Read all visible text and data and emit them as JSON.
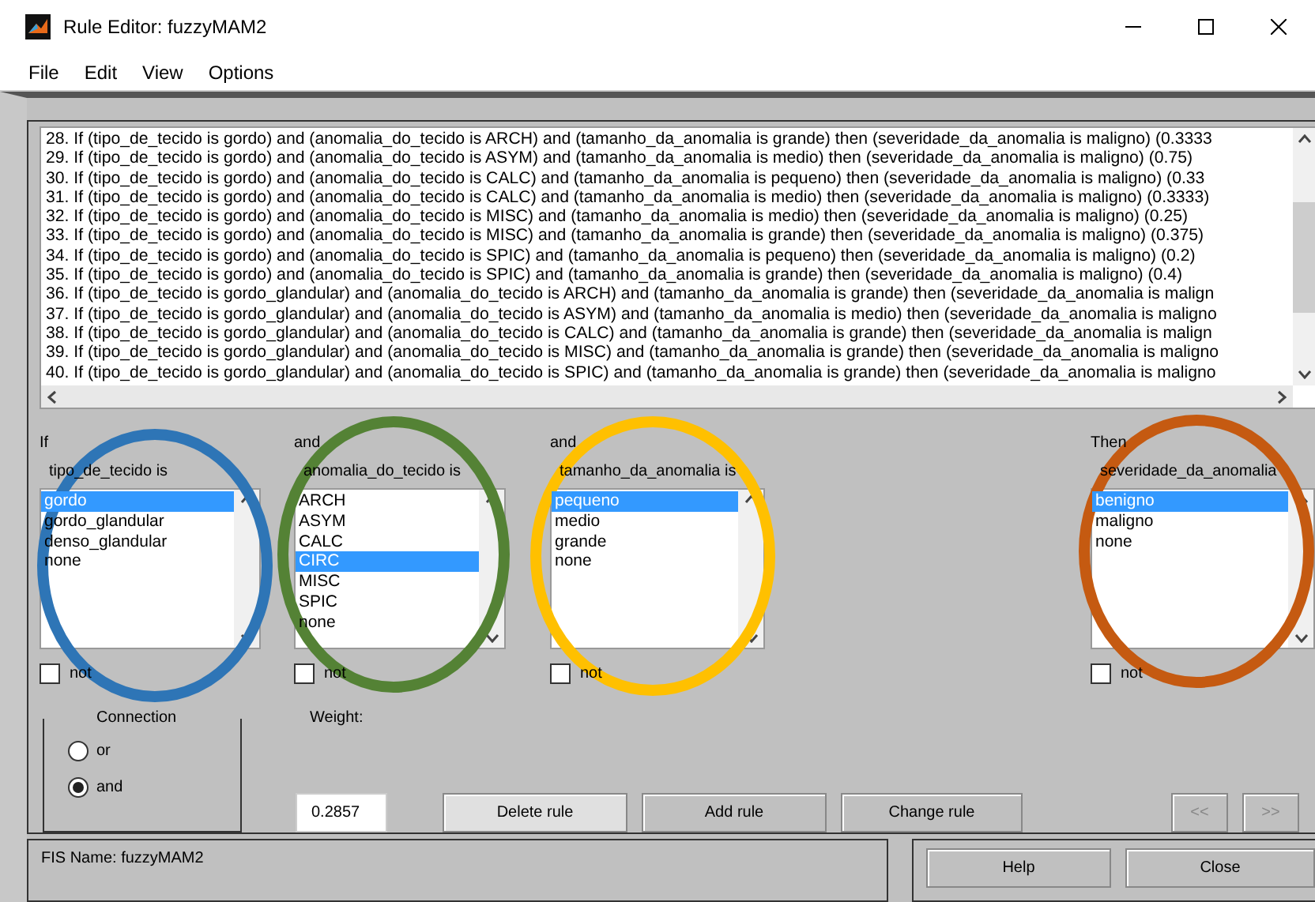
{
  "window": {
    "title": "Rule Editor: fuzzyMAM2"
  },
  "menu": [
    "File",
    "Edit",
    "View",
    "Options"
  ],
  "rules": [
    "28. If (tipo_de_tecido is gordo) and (anomalia_do_tecido is ARCH) and (tamanho_da_anomalia is grande) then (severidade_da_anomalia is maligno) (0.3333",
    "29. If (tipo_de_tecido is gordo) and (anomalia_do_tecido is ASYM) and (tamanho_da_anomalia is medio) then (severidade_da_anomalia is maligno) (0.75)",
    "30. If (tipo_de_tecido is gordo) and (anomalia_do_tecido is CALC) and (tamanho_da_anomalia is pequeno) then (severidade_da_anomalia is maligno) (0.33",
    "31. If (tipo_de_tecido is gordo) and (anomalia_do_tecido is CALC) and (tamanho_da_anomalia is medio) then (severidade_da_anomalia is maligno) (0.3333)",
    "32. If (tipo_de_tecido is gordo) and (anomalia_do_tecido is MISC) and (tamanho_da_anomalia is medio) then (severidade_da_anomalia is maligno) (0.25)",
    "33. If (tipo_de_tecido is gordo) and (anomalia_do_tecido is MISC) and (tamanho_da_anomalia is grande) then (severidade_da_anomalia is maligno) (0.375)",
    "34. If (tipo_de_tecido is gordo) and (anomalia_do_tecido is SPIC) and (tamanho_da_anomalia is pequeno) then (severidade_da_anomalia is maligno) (0.2)",
    "35. If (tipo_de_tecido is gordo) and (anomalia_do_tecido is SPIC) and (tamanho_da_anomalia is grande) then (severidade_da_anomalia is maligno) (0.4)",
    "36. If (tipo_de_tecido is gordo_glandular) and (anomalia_do_tecido is ARCH) and (tamanho_da_anomalia is grande) then (severidade_da_anomalia is malign",
    "37. If (tipo_de_tecido is gordo_glandular) and (anomalia_do_tecido is ASYM) and (tamanho_da_anomalia is medio) then (severidade_da_anomalia is maligno",
    "38. If (tipo_de_tecido is gordo_glandular) and (anomalia_do_tecido is CALC) and (tamanho_da_anomalia is grande) then (severidade_da_anomalia is malign",
    "39. If (tipo_de_tecido is gordo_glandular) and (anomalia_do_tecido is MISC) and (tamanho_da_anomalia is grande) then (severidade_da_anomalia is maligno",
    "40. If (tipo_de_tecido is gordo_glandular) and (anomalia_do_tecido is SPIC) and (tamanho_da_anomalia is grande) then (severidade_da_anomalia is maligno"
  ],
  "selectors": [
    {
      "header": "If",
      "variable": "tipo_de_tecido is",
      "items": [
        {
          "label": "gordo",
          "selected": true
        },
        {
          "label": "gordo_glandular",
          "selected": false
        },
        {
          "label": "denso_glandular",
          "selected": false
        },
        {
          "label": "none",
          "selected": false
        }
      ],
      "negate": {
        "label": "not",
        "checked": false
      }
    },
    {
      "header": "and",
      "variable": "anomalia_do_tecido is",
      "items": [
        {
          "label": "ARCH",
          "selected": false
        },
        {
          "label": "ASYM",
          "selected": false
        },
        {
          "label": "CALC",
          "selected": false
        },
        {
          "label": "CIRC",
          "selected": true
        },
        {
          "label": "MISC",
          "selected": false
        },
        {
          "label": "SPIC",
          "selected": false
        },
        {
          "label": "none",
          "selected": false
        }
      ],
      "negate": {
        "label": "not",
        "checked": false
      }
    },
    {
      "header": "and",
      "variable": "tamanho_da_anomalia is",
      "items": [
        {
          "label": "pequeno",
          "selected": true
        },
        {
          "label": "medio",
          "selected": false
        },
        {
          "label": "grande",
          "selected": false
        },
        {
          "label": "none",
          "selected": false
        }
      ],
      "negate": {
        "label": "not",
        "checked": false
      }
    },
    {
      "header": "Then",
      "variable": "severidade_da_anomalia",
      "items": [
        {
          "label": "benigno",
          "selected": true
        },
        {
          "label": "maligno",
          "selected": false
        },
        {
          "label": "none",
          "selected": false
        }
      ],
      "negate": {
        "label": "not",
        "checked": false
      }
    }
  ],
  "connection": {
    "title": "Connection",
    "options": [
      {
        "label": "or",
        "selected": false
      },
      {
        "label": "and",
        "selected": true
      }
    ]
  },
  "weight": {
    "label": "Weight:",
    "value": "0.2857"
  },
  "buttons": [
    {
      "label": "Delete rule",
      "disabled": false
    },
    {
      "label": "Add rule",
      "disabled": false
    },
    {
      "label": "Change rule",
      "disabled": false
    },
    {
      "label": "<<",
      "disabled": true
    },
    {
      "label": ">>",
      "disabled": true
    }
  ],
  "status": "FIS Name: fuzzyMAM2",
  "footer_buttons": [
    "Help",
    "Close"
  ],
  "marks": [
    {
      "color": "#2e75b6"
    },
    {
      "color": "#548235"
    },
    {
      "color": "#ffc000"
    },
    {
      "color": "#c55a11"
    }
  ]
}
